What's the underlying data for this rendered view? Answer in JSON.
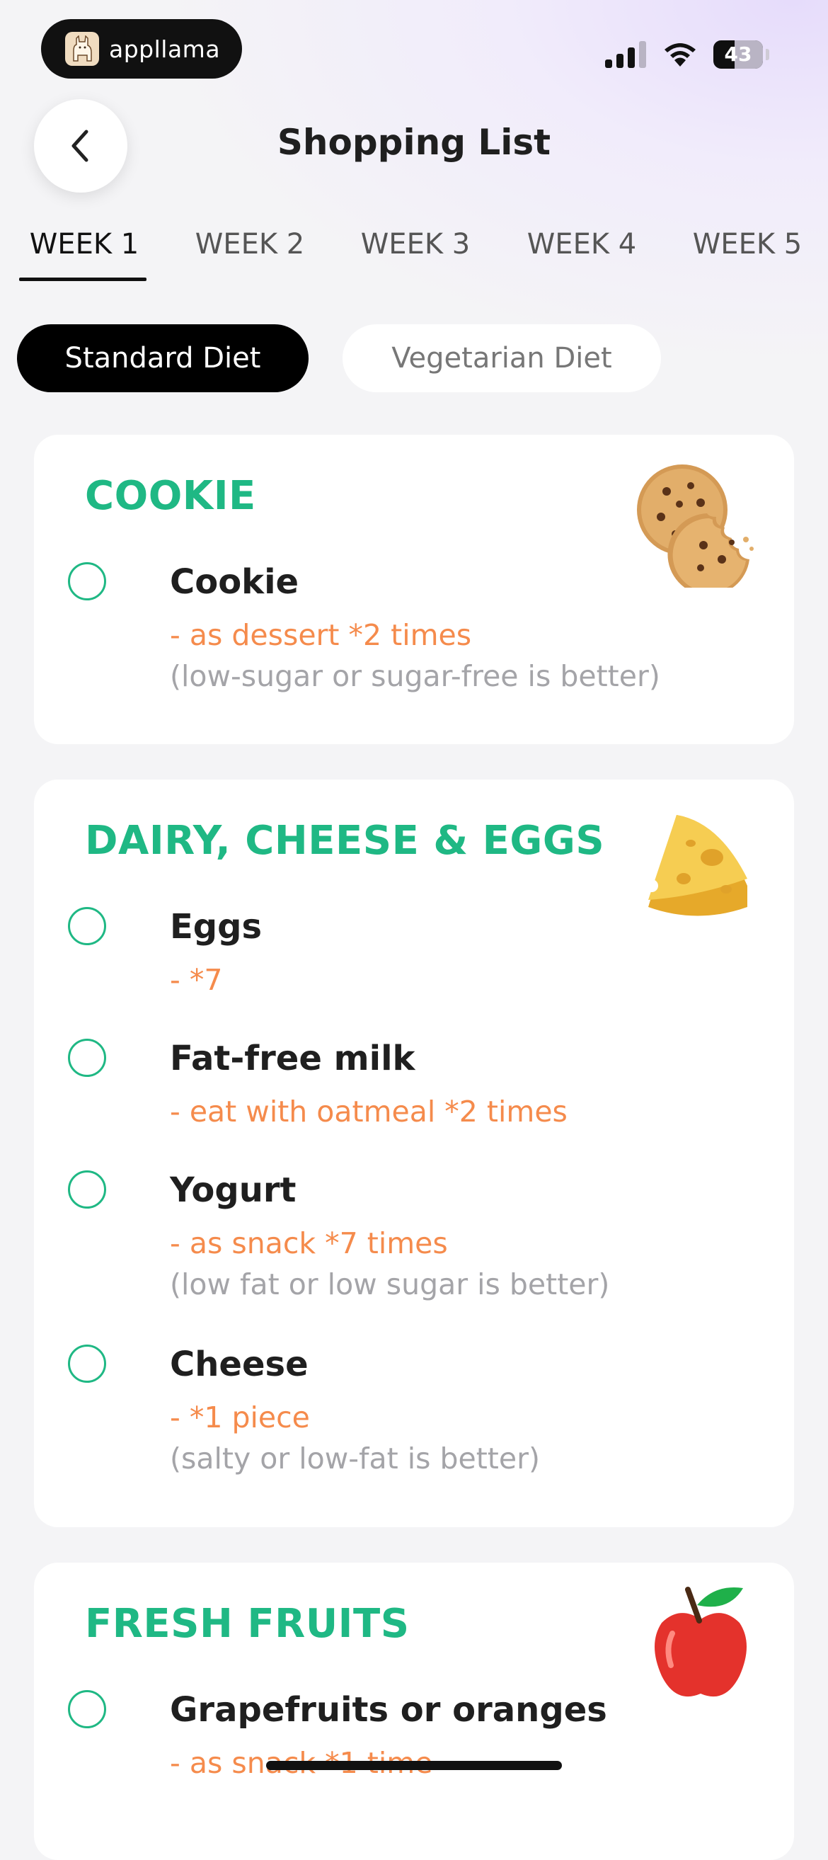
{
  "status_bar": {
    "brand": "appllama",
    "battery": "43",
    "icons": [
      "llama-logo-icon",
      "cellular-signal-icon",
      "wifi-icon",
      "battery-icon"
    ]
  },
  "header": {
    "title": "Shopping List",
    "back_icon": "chevron-left-icon"
  },
  "weeks": {
    "active_index": 0,
    "tabs": [
      "WEEK 1",
      "WEEK 2",
      "WEEK 3",
      "WEEK 4",
      "WEEK 5"
    ]
  },
  "diet": {
    "options": [
      "Standard Diet",
      "Vegetarian Diet"
    ],
    "selected": "Standard Diet"
  },
  "categories": [
    {
      "title": "COOKIE",
      "icon": "cookie-icon",
      "items": [
        {
          "name": "Cookie",
          "note": "- as dessert *2 times",
          "hint": "(low-sugar or sugar-free is better)",
          "checked": false
        }
      ]
    },
    {
      "title": "DAIRY, CHEESE & EGGS",
      "icon": "cheese-icon",
      "items": [
        {
          "name": "Eggs",
          "note": "- *7",
          "hint": "",
          "checked": false
        },
        {
          "name": "Fat-free milk",
          "note": "- eat with oatmeal *2 times",
          "hint": "",
          "checked": false
        },
        {
          "name": "Yogurt",
          "note": "- as snack *7 times",
          "hint": "(low fat or low sugar is better)",
          "checked": false
        },
        {
          "name": "Cheese",
          "note": "- *1 piece",
          "hint": "(salty or low-fat is better)",
          "checked": false
        }
      ]
    },
    {
      "title": "FRESH FRUITS",
      "icon": "apple-icon",
      "items": [
        {
          "name": "Grapefruits or oranges",
          "note": "- as snack *1 time",
          "hint": "",
          "checked": false
        }
      ]
    }
  ],
  "colors": {
    "accent_green": "#1fb884",
    "note_orange": "#f58b4c",
    "hint_gray": "#a4a4a8",
    "active_black": "#000000"
  }
}
